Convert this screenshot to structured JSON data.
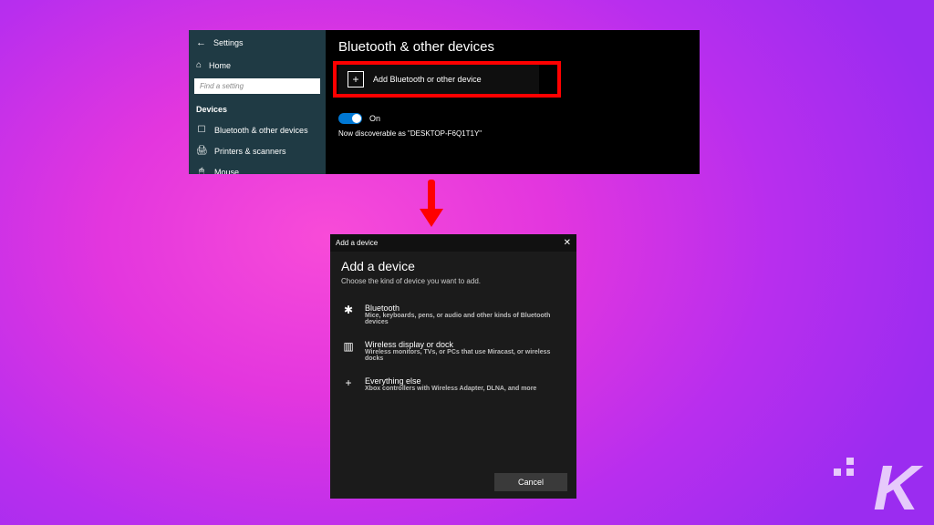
{
  "settings": {
    "app_title": "Settings",
    "home_label": "Home",
    "search_placeholder": "Find a setting",
    "section_header": "Devices",
    "nav": {
      "bluetooth": "Bluetooth & other devices",
      "printers": "Printers & scanners",
      "mouse": "Mouse"
    },
    "page_title": "Bluetooth & other devices",
    "add_btn_label": "Add Bluetooth or other device",
    "toggle_label": "On",
    "discoverable_text": "Now discoverable as \"DESKTOP-F6Q1T1Y\""
  },
  "dialog": {
    "titlebar": "Add a device",
    "heading": "Add a device",
    "subheading": "Choose the kind of device you want to add.",
    "options": {
      "bluetooth": {
        "title": "Bluetooth",
        "desc": "Mice, keyboards, pens, or audio and other kinds of Bluetooth devices"
      },
      "wireless": {
        "title": "Wireless display or dock",
        "desc": "Wireless monitors, TVs, or PCs that use Miracast, or wireless docks"
      },
      "everything": {
        "title": "Everything else",
        "desc": "Xbox controllers with Wireless Adapter, DLNA, and more"
      }
    },
    "cancel_label": "Cancel"
  },
  "logo": {
    "letter": "K"
  }
}
